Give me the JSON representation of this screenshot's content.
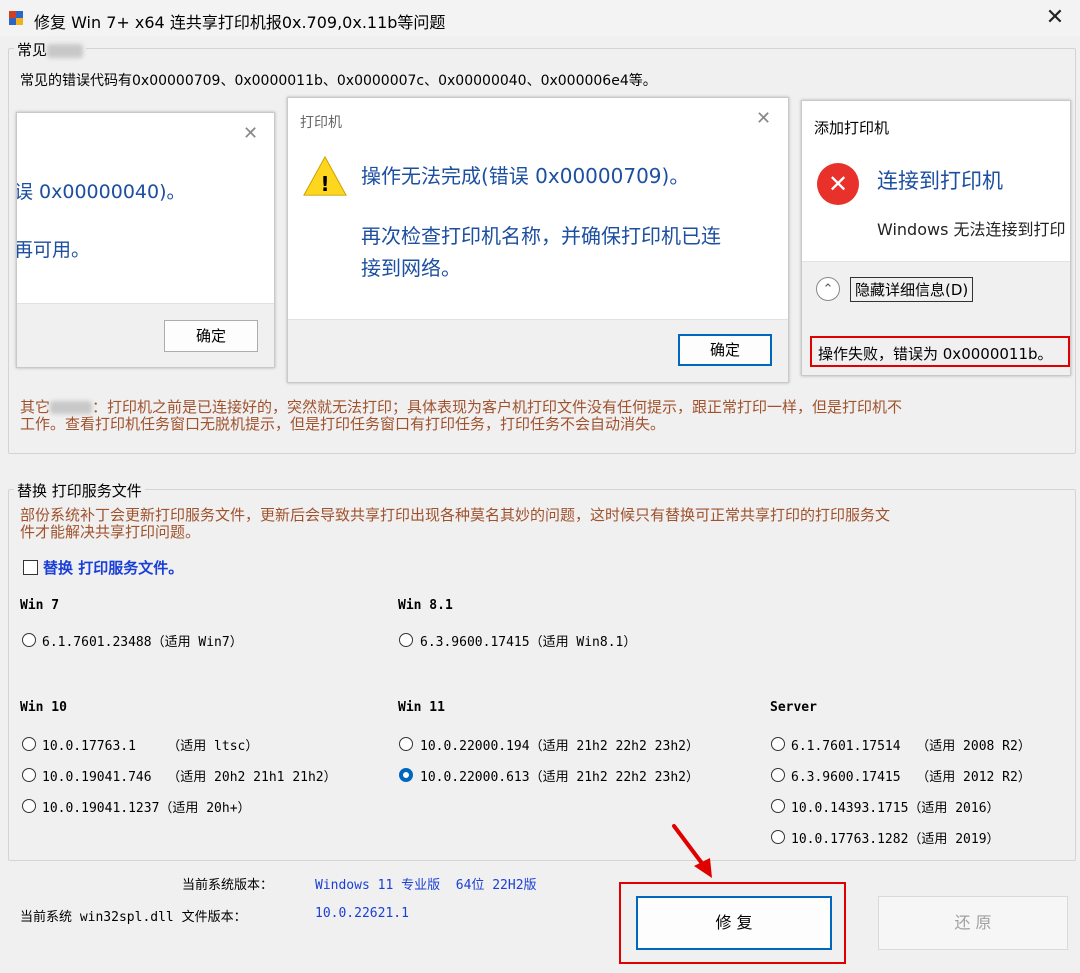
{
  "window": {
    "title": "修复 Win 7+ x64 连共享打印机报0x.709,0x.11b等问题",
    "icon": "printer-app-icon",
    "close_glyph": "✕"
  },
  "common_group": {
    "legend": "常见",
    "error_codes_line": "常见的错误代码有0x00000709、0x0000011b、0x0000007c、0x00000040、0x000006e4等。",
    "other_prefix": "其它",
    "other_line1": "：打印机之前是已连接好的，突然就无法打印；具体表现为客户机打印文件没有任何提示，跟正常打印一样，但是打印机不",
    "other_line2": "工作。查看打印机任务窗口无脱机提示，但是打印任务窗口有打印任务，打印任务不会自动消失。"
  },
  "dialog_left": {
    "close_glyph": "✕",
    "line1": "误 0x00000040)。",
    "line2": "再可用。",
    "ok_label": "确定"
  },
  "dialog_mid": {
    "title": "打印机",
    "close_glyph": "✕",
    "warning_glyph": "!",
    "message": "操作无法完成(错误 0x00000709)。",
    "detail_line1": "再次检查打印机名称，并确保打印机已连",
    "detail_line2": "接到网络。",
    "ok_label": "确定"
  },
  "dialog_right": {
    "title": "添加打印机",
    "error_glyph": "✕",
    "heading": "连接到打印机",
    "message": "Windows 无法连接到打印",
    "chevron_glyph": "⌃",
    "hide_details": "隐藏详细信息(D)",
    "error_detail": "操作失败，错误为 0x0000011b。"
  },
  "replace_group": {
    "legend": "替换 打印服务文件",
    "description_line1": "部份系统补丁会更新打印服务文件，更新后会导致共享打印出现各种莫名其妙的问题，这时候只有替换可正常共享打印的打印服务文",
    "description_line2": "件才能解决共享打印问题。",
    "checkbox_label": "替换 打印服务文件。",
    "checkbox_checked": false,
    "win7": {
      "heading": "Win 7",
      "options": [
        {
          "label": "6.1.7601.23488（适用 Win7）",
          "checked": false
        }
      ]
    },
    "win81": {
      "heading": "Win 8.1",
      "options": [
        {
          "label": "6.3.9600.17415（适用 Win8.1）",
          "checked": false
        }
      ]
    },
    "win10": {
      "heading": "Win 10",
      "options": [
        {
          "label": "10.0.17763.1    （适用 ltsc）",
          "checked": false
        },
        {
          "label": "10.0.19041.746  （适用 20h2 21h1 21h2）",
          "checked": false
        },
        {
          "label": "10.0.19041.1237（适用 20h+）",
          "checked": false
        }
      ]
    },
    "win11": {
      "heading": "Win 11",
      "options": [
        {
          "label": "10.0.22000.194（适用 21h2 22h2 23h2）",
          "checked": false
        },
        {
          "label": "10.0.22000.613（适用 21h2 22h2 23h2）",
          "checked": true
        }
      ]
    },
    "server": {
      "heading": "Server",
      "options": [
        {
          "label": "6.1.7601.17514  （适用 2008 R2）",
          "checked": false
        },
        {
          "label": "6.3.9600.17415  （适用 2012 R2）",
          "checked": false
        },
        {
          "label": "10.0.14393.1715（适用 2016）",
          "checked": false
        },
        {
          "label": "10.0.17763.1282（适用 2019）",
          "checked": false
        }
      ]
    }
  },
  "status": {
    "os_version_label": "当前系统版本：",
    "os_version_value": "Windows 11 专业版  64位 22H2版",
    "dll_version_label": "当前系统 win32spl.dll 文件版本：",
    "dll_version_value": "10.0.22621.1"
  },
  "actions": {
    "repair_label": "修 复",
    "restore_label": "还 原"
  },
  "colors": {
    "accent": "#0067c0",
    "link_blue": "#1a3fd6",
    "brown_text": "#a0522d",
    "highlight_red": "#e00000"
  }
}
